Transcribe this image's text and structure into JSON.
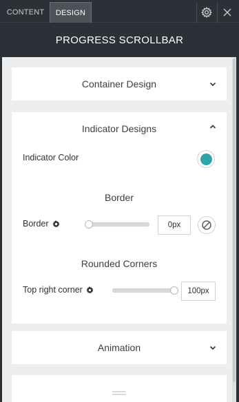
{
  "tabs": [
    {
      "label": "CONTENT",
      "active": false
    },
    {
      "label": "DESIGN",
      "active": true
    }
  ],
  "header": {
    "title": "PROGRESS SCROLLBAR"
  },
  "icons": {
    "settings": "gear-icon",
    "close": "close-icon"
  },
  "sections": {
    "container": {
      "title": "Container Design",
      "expanded": false
    },
    "indicator": {
      "title": "Indicator Designs",
      "expanded": true,
      "color_label": "Indicator Color",
      "color_value": "#2ba5a8",
      "border_title": "Border",
      "border_label": "Border",
      "border_value": "0px",
      "border_slider": 0.0,
      "corners_title": "Rounded Corners",
      "corner_label": "Top right corner",
      "corner_value": "100px",
      "corner_slider": 1.0
    },
    "animation": {
      "title": "Animation",
      "expanded": false
    }
  },
  "colors": {
    "accent": "#2ba5a8",
    "panel_dark": "#2b3136"
  }
}
